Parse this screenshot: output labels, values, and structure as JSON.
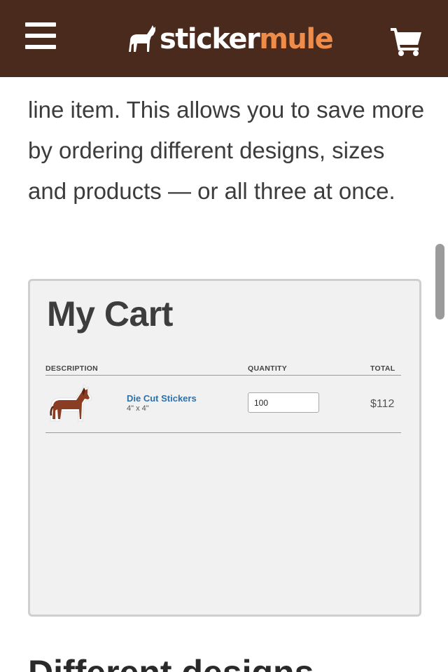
{
  "header": {
    "logo_part1": "sticker",
    "logo_part2": "mule",
    "bg_color": "#4a2a1c",
    "accent_color": "#f08c4a"
  },
  "intro": {
    "text": "line item. This allows you to save more by ordering different designs, sizes and products — or all three at once."
  },
  "cart": {
    "title": "My Cart",
    "columns": {
      "description": "DESCRIPTION",
      "quantity": "QUANTITY",
      "total": "TOTAL"
    },
    "items": [
      {
        "name": "Die Cut Stickers",
        "size": "4\" x 4\"",
        "quantity": "100",
        "total": "$112",
        "thumbnail": "horse-sticker-image"
      }
    ]
  },
  "next_heading": "Different designs"
}
